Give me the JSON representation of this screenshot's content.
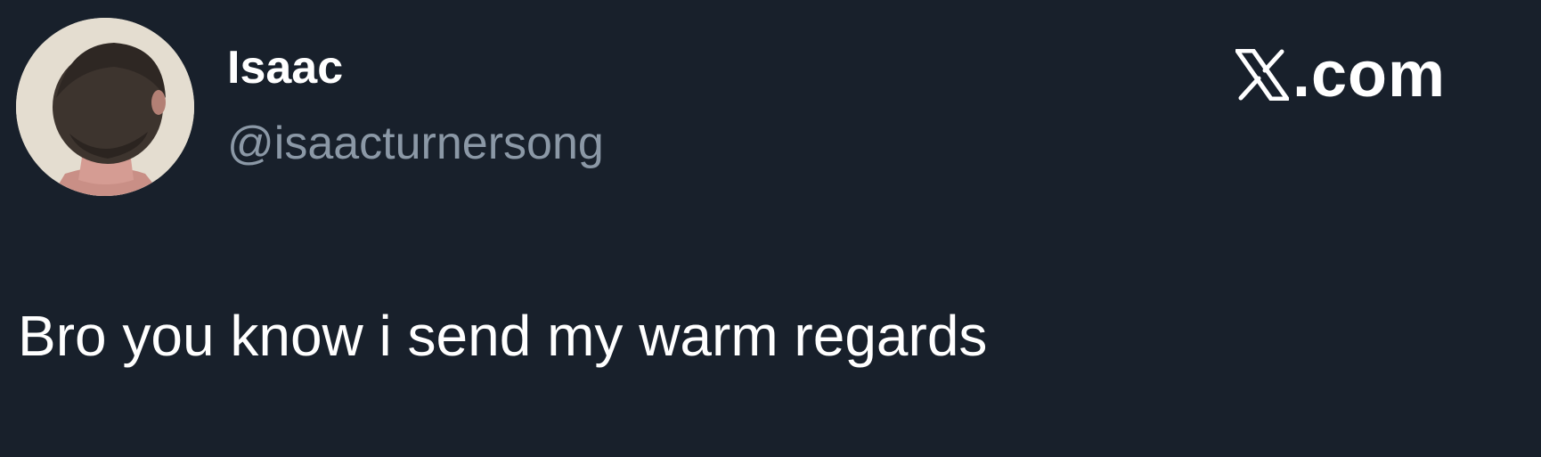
{
  "author": {
    "display_name": "Isaac",
    "handle": "@isaacturnersong",
    "avatar_icon": "person-back-of-head-avatar"
  },
  "brand": {
    "logo_icon": "x-logo-icon",
    "text": ".com"
  },
  "tweet": {
    "text": "Bro you know i send my warm regards"
  },
  "colors": {
    "background": "#18202b",
    "primary_text": "#ffffff",
    "secondary_text": "#8b98a6"
  }
}
